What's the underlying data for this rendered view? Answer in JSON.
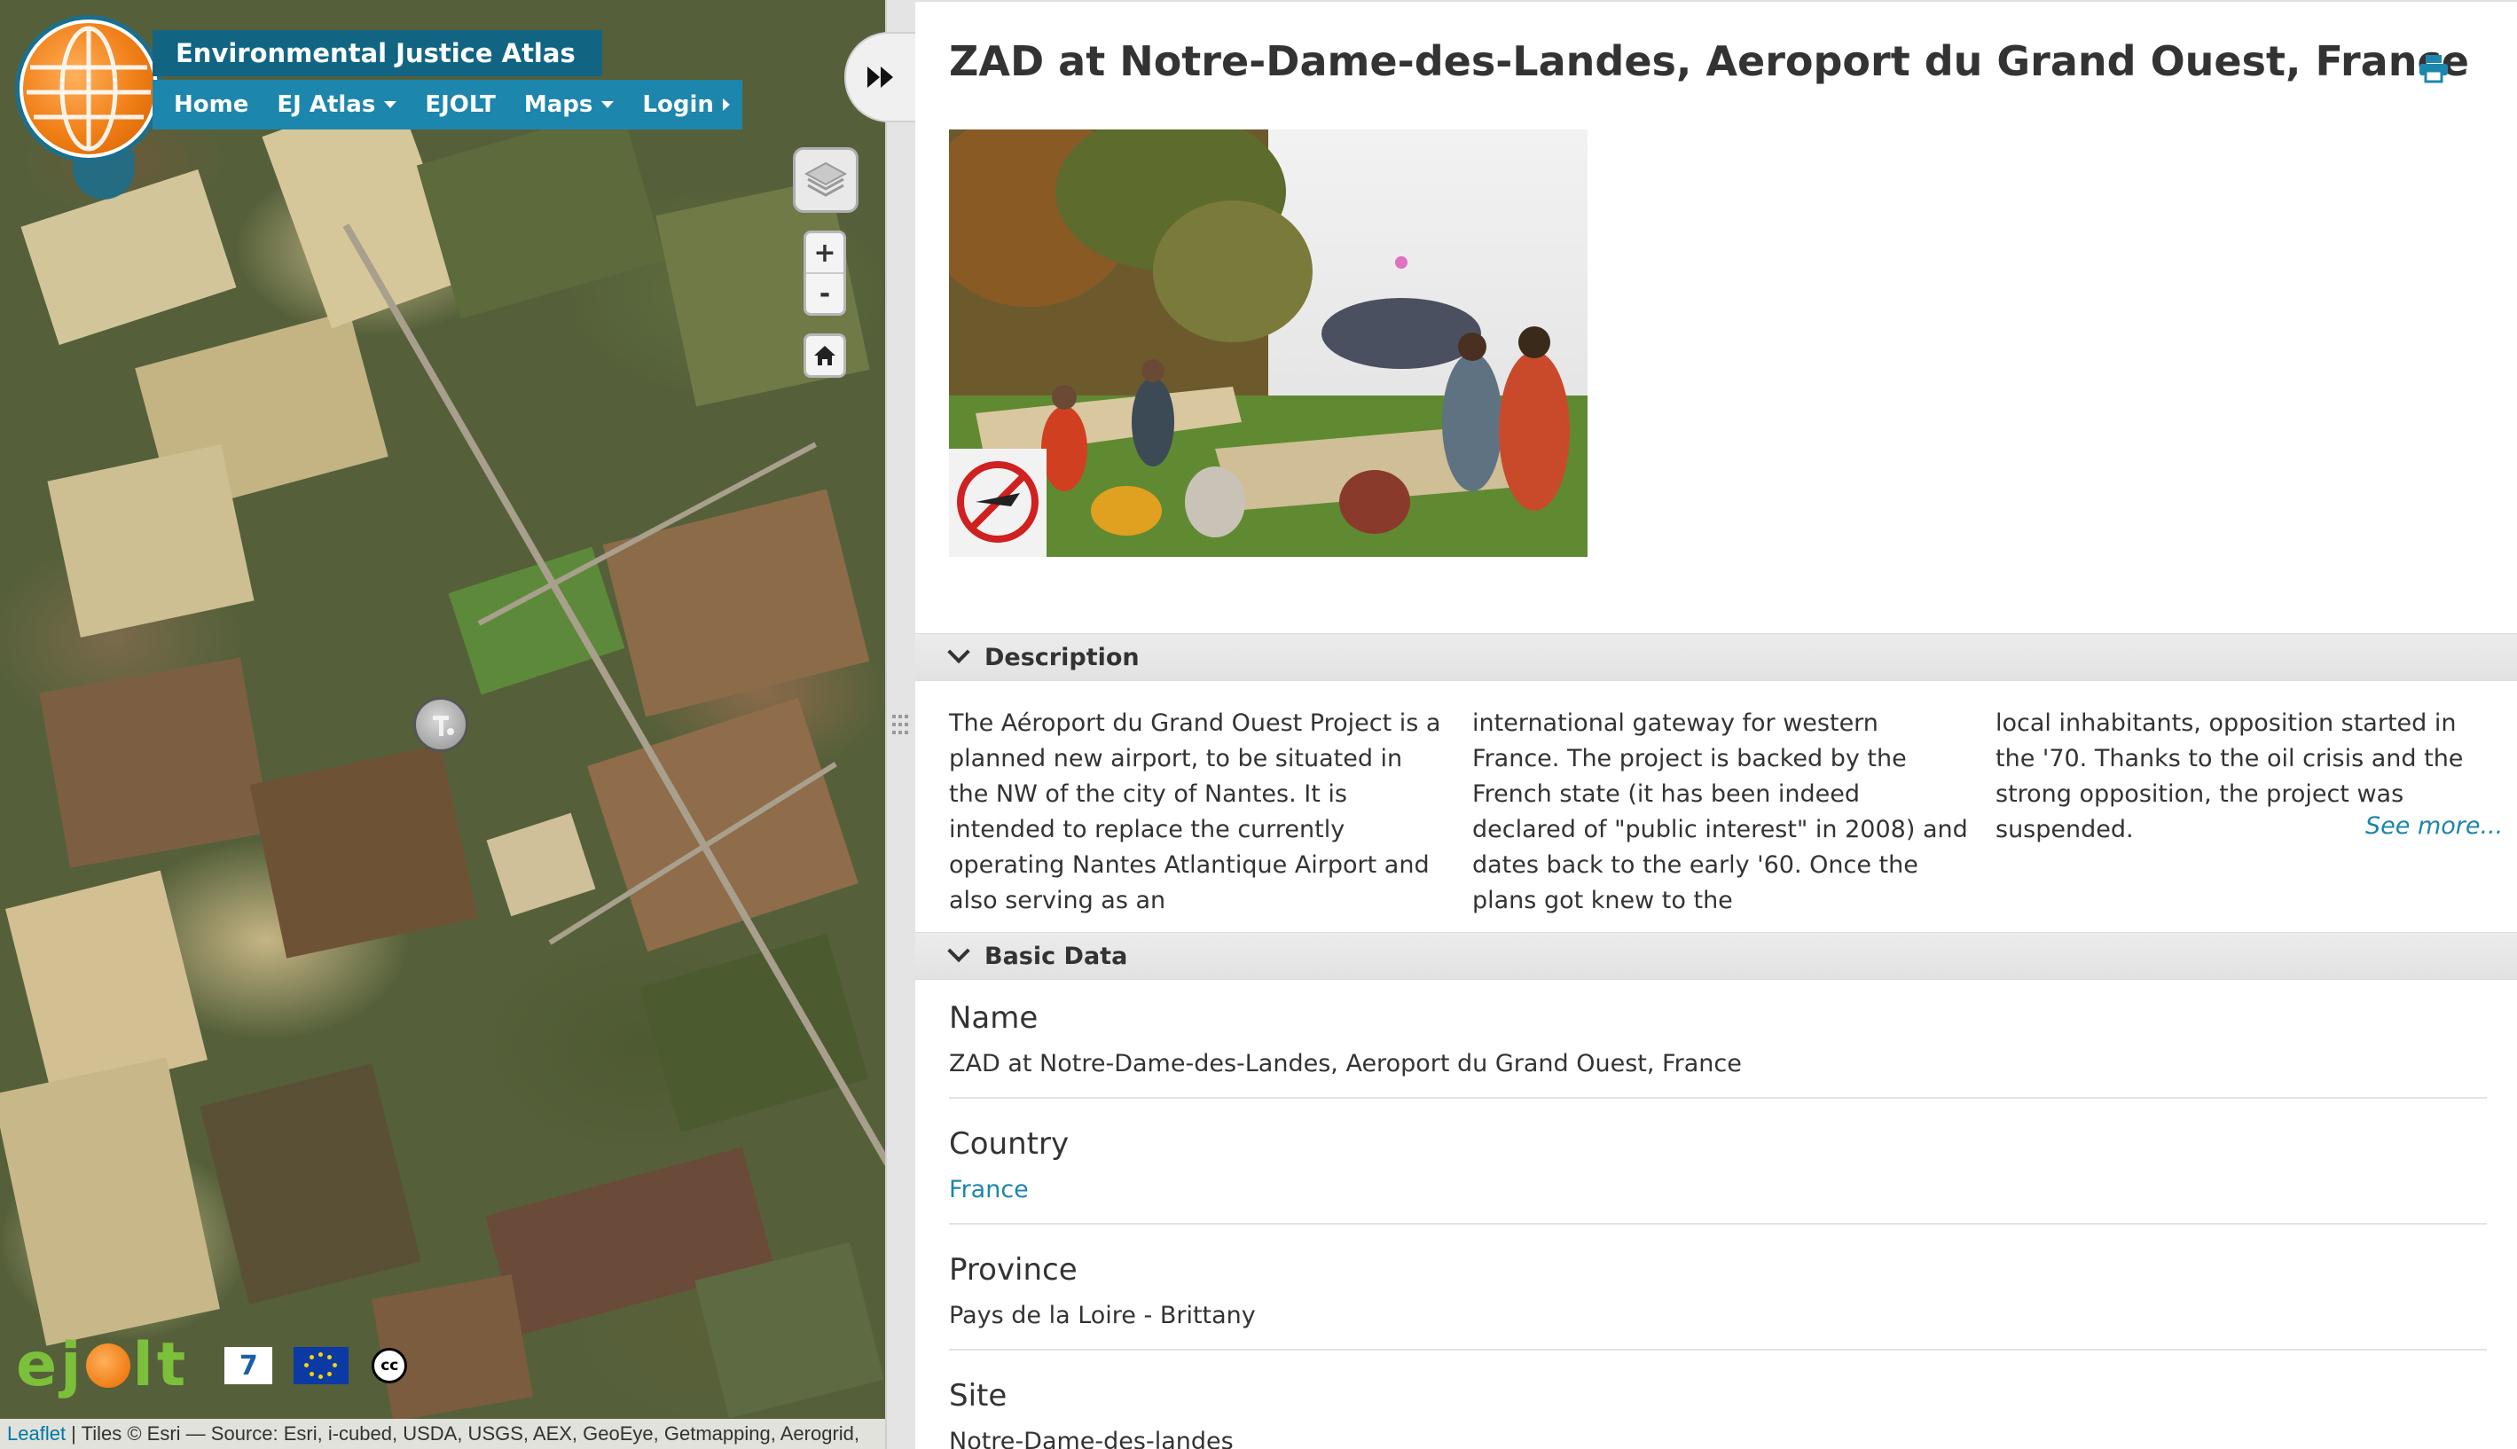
{
  "brand": {
    "title": "Environmental Justice Atlas"
  },
  "nav": {
    "items": [
      {
        "label": "Home"
      },
      {
        "label": "EJ Atlas"
      },
      {
        "label": "EJOLT"
      },
      {
        "label": "Maps"
      },
      {
        "label": "Login"
      }
    ]
  },
  "map": {
    "zoom_in": "+",
    "zoom_out": "-",
    "logos": {
      "ejolt_a": "ej",
      "ejolt_b": "lt",
      "fp7": "7",
      "cc": "cc"
    },
    "attribution": {
      "leaflet": "Leaflet",
      "text": " | Tiles © Esri — Source: Esri, i-cubed, USDA, USGS, AEX, GeoEye, Getmapping, Aerogrid,"
    }
  },
  "detail": {
    "title": "ZAD at Notre-Dame-des-Landes, Aeroport du Grand Ouest, France",
    "description_section": "Description",
    "description_cols": [
      "The Aéroport du Grand Ouest Project is a planned new airport, to be situated in the NW of the city of Nantes. It is intended to replace the currently operating Nantes Atlantique Airport and also serving as an",
      "international gateway for western France. The project is backed by the French state (it has been indeed declared of \"public interest\" in 2008) and dates back to the early '60. Once the plans got knew to the",
      "local inhabitants, opposition started in the '70. Thanks to the oil crisis and the strong opposition, the project was suspended."
    ],
    "see_more": "See more...",
    "basic_section": "Basic Data",
    "fields": [
      {
        "label": "Name",
        "value": "ZAD at Notre-Dame-des-Landes, Aeroport du Grand Ouest, France"
      },
      {
        "label": "Country",
        "value": "France"
      },
      {
        "label": "Province",
        "value": "Pays de la Loire - Brittany"
      },
      {
        "label": "Site",
        "value": "Notre-Dame-des-landes"
      }
    ]
  },
  "colors": {
    "accent": "#1c86ad",
    "brand_dark": "#116583",
    "brand_orange": "#f07e16"
  },
  "icons": [
    "layers-icon",
    "home-icon",
    "print-icon",
    "fast-forward-icon",
    "marker-icon",
    "chevron-down-icon"
  ]
}
